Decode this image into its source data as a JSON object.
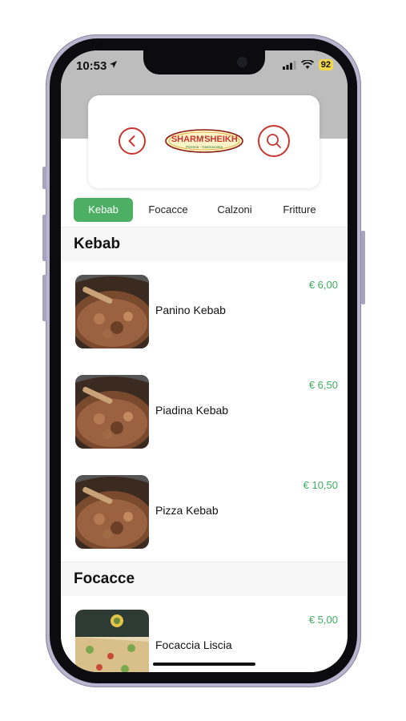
{
  "status": {
    "time": "10:53",
    "battery": "92"
  },
  "header": {
    "back_icon": "chevron-left-icon",
    "search_icon": "search-icon",
    "logo_main": "SHARM",
    "logo_el": "el",
    "logo_sheikh": "SHEIKH",
    "logo_sub": "Pizzeria - Gastronomia"
  },
  "tabs": [
    {
      "label": "Kebab",
      "active": true
    },
    {
      "label": "Focacce",
      "active": false
    },
    {
      "label": "Calzoni",
      "active": false
    },
    {
      "label": "Fritture",
      "active": false
    }
  ],
  "sections": [
    {
      "title": "Kebab",
      "items": [
        {
          "name": "Panino Kebab",
          "price": "€ 6,00"
        },
        {
          "name": "Piadina Kebab",
          "price": "€ 6,50"
        },
        {
          "name": "Pizza Kebab",
          "price": "€ 10,50"
        }
      ]
    },
    {
      "title": "Focacce",
      "items": [
        {
          "name": "Focaccia Liscia",
          "price": "€ 5,00"
        }
      ]
    }
  ],
  "colors": {
    "accent_green": "#4caf64",
    "price_green": "#3fae5f",
    "brand_red": "#c8352f"
  }
}
